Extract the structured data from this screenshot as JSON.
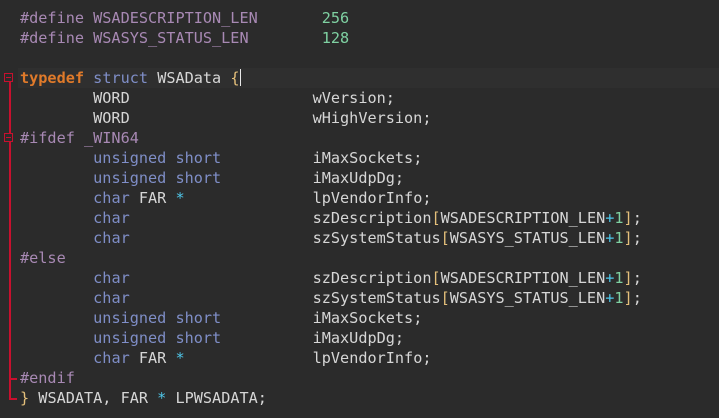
{
  "editor": {
    "colors": {
      "background": "#2b2b2b",
      "default_text": "#d6d6d6",
      "preprocessor": "#a889b4",
      "keyword_type": "#7f8ec7",
      "typedef_keyword": "#e07a2a",
      "number": "#7fd1a2",
      "operator": "#4fc6e8",
      "brace_bracket": "#e5c07b",
      "fold_marker": "#c8102e"
    },
    "lines": [
      [
        {
          "t": "#define WSADESCRIPTION_LEN       ",
          "c": "pp"
        },
        {
          "t": "256",
          "c": "num"
        }
      ],
      [
        {
          "t": "#define WSASYS_STATUS_LEN        ",
          "c": "pp"
        },
        {
          "t": "128",
          "c": "num"
        }
      ],
      [
        {
          "t": "",
          "c": "txt"
        }
      ],
      [
        {
          "t": "typedef",
          "c": "tdef"
        },
        {
          "t": " ",
          "c": "txt"
        },
        {
          "t": "struct",
          "c": "kw"
        },
        {
          "t": " WSAData ",
          "c": "txt"
        },
        {
          "t": "{",
          "c": "brace"
        }
      ],
      [
        {
          "t": "        WORD                    wVersion;",
          "c": "txt"
        }
      ],
      [
        {
          "t": "        WORD                    wHighVersion;",
          "c": "txt"
        }
      ],
      [
        {
          "t": "#ifdef _WIN64",
          "c": "pp"
        }
      ],
      [
        {
          "t": "        ",
          "c": "txt"
        },
        {
          "t": "unsigned short",
          "c": "kw"
        },
        {
          "t": "          iMaxSockets;",
          "c": "txt"
        }
      ],
      [
        {
          "t": "        ",
          "c": "txt"
        },
        {
          "t": "unsigned short",
          "c": "kw"
        },
        {
          "t": "          iMaxUdpDg;",
          "c": "txt"
        }
      ],
      [
        {
          "t": "        ",
          "c": "txt"
        },
        {
          "t": "char",
          "c": "kw"
        },
        {
          "t": " FAR ",
          "c": "txt"
        },
        {
          "t": "*",
          "c": "op"
        },
        {
          "t": "              lpVendorInfo;",
          "c": "txt"
        }
      ],
      [
        {
          "t": "        ",
          "c": "txt"
        },
        {
          "t": "char",
          "c": "kw"
        },
        {
          "t": "                    szDescription",
          "c": "txt"
        },
        {
          "t": "[",
          "c": "brace"
        },
        {
          "t": "WSADESCRIPTION_LEN",
          "c": "txt"
        },
        {
          "t": "+",
          "c": "op"
        },
        {
          "t": "1",
          "c": "num"
        },
        {
          "t": "]",
          "c": "brace"
        },
        {
          "t": ";",
          "c": "txt"
        }
      ],
      [
        {
          "t": "        ",
          "c": "txt"
        },
        {
          "t": "char",
          "c": "kw"
        },
        {
          "t": "                    szSystemStatus",
          "c": "txt"
        },
        {
          "t": "[",
          "c": "brace"
        },
        {
          "t": "WSASYS_STATUS_LEN",
          "c": "txt"
        },
        {
          "t": "+",
          "c": "op"
        },
        {
          "t": "1",
          "c": "num"
        },
        {
          "t": "]",
          "c": "brace"
        },
        {
          "t": ";",
          "c": "txt"
        }
      ],
      [
        {
          "t": "#else",
          "c": "pp"
        }
      ],
      [
        {
          "t": "        ",
          "c": "txt"
        },
        {
          "t": "char",
          "c": "kw"
        },
        {
          "t": "                    szDescription",
          "c": "txt"
        },
        {
          "t": "[",
          "c": "brace"
        },
        {
          "t": "WSADESCRIPTION_LEN",
          "c": "txt"
        },
        {
          "t": "+",
          "c": "op"
        },
        {
          "t": "1",
          "c": "num"
        },
        {
          "t": "]",
          "c": "brace"
        },
        {
          "t": ";",
          "c": "txt"
        }
      ],
      [
        {
          "t": "        ",
          "c": "txt"
        },
        {
          "t": "char",
          "c": "kw"
        },
        {
          "t": "                    szSystemStatus",
          "c": "txt"
        },
        {
          "t": "[",
          "c": "brace"
        },
        {
          "t": "WSASYS_STATUS_LEN",
          "c": "txt"
        },
        {
          "t": "+",
          "c": "op"
        },
        {
          "t": "1",
          "c": "num"
        },
        {
          "t": "]",
          "c": "brace"
        },
        {
          "t": ";",
          "c": "txt"
        }
      ],
      [
        {
          "t": "        ",
          "c": "txt"
        },
        {
          "t": "unsigned short",
          "c": "kw"
        },
        {
          "t": "          iMaxSockets;",
          "c": "txt"
        }
      ],
      [
        {
          "t": "        ",
          "c": "txt"
        },
        {
          "t": "unsigned short",
          "c": "kw"
        },
        {
          "t": "          iMaxUdpDg;",
          "c": "txt"
        }
      ],
      [
        {
          "t": "        ",
          "c": "txt"
        },
        {
          "t": "char",
          "c": "kw"
        },
        {
          "t": " FAR ",
          "c": "txt"
        },
        {
          "t": "*",
          "c": "op"
        },
        {
          "t": "              lpVendorInfo;",
          "c": "txt"
        }
      ],
      [
        {
          "t": "#endif",
          "c": "pp"
        }
      ],
      [
        {
          "t": "}",
          "c": "brace"
        },
        {
          "t": " WSADATA, FAR ",
          "c": "txt"
        },
        {
          "t": "*",
          "c": "op"
        },
        {
          "t": " LPWSADATA;",
          "c": "txt"
        }
      ]
    ]
  }
}
